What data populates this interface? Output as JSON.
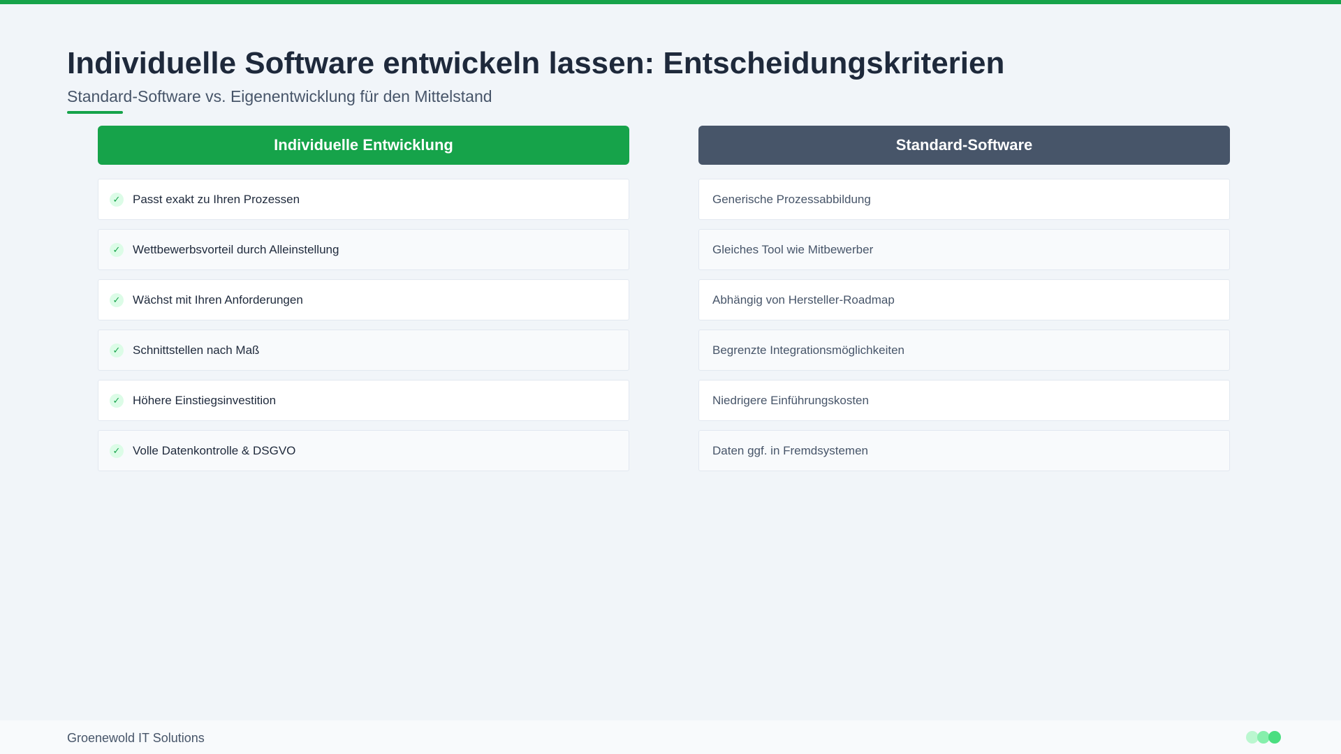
{
  "header": {
    "title": "Individuelle Software entwickeln lassen: Entscheidungskriterien",
    "subtitle": "Standard-Software vs. Eigenentwicklung für den Mittelstand"
  },
  "comparison": {
    "left": {
      "title": "Individuelle Entwicklung",
      "check_glyph": "✓",
      "items": [
        "Passt exakt zu Ihren Prozessen",
        "Wettbewerbsvorteil durch Alleinstellung",
        "Wächst mit Ihren Anforderungen",
        "Schnittstellen nach Maß",
        "Höhere Einstiegsinvestition",
        "Volle Datenkontrolle & DSGVO"
      ]
    },
    "right": {
      "title": "Standard-Software",
      "items": [
        "Generische Prozessabbildung",
        "Gleiches Tool wie Mitbewerber",
        "Abhängig von Hersteller-Roadmap",
        "Begrenzte Integrationsmöglichkeiten",
        "Niedrigere Einführungskosten",
        "Daten ggf. in Fremdsystemen"
      ]
    }
  },
  "footer": {
    "brand": "Groenewold IT Solutions"
  },
  "colors": {
    "accent": "#16a34a",
    "secondary_header": "#475569",
    "background": "#f1f5f9"
  }
}
